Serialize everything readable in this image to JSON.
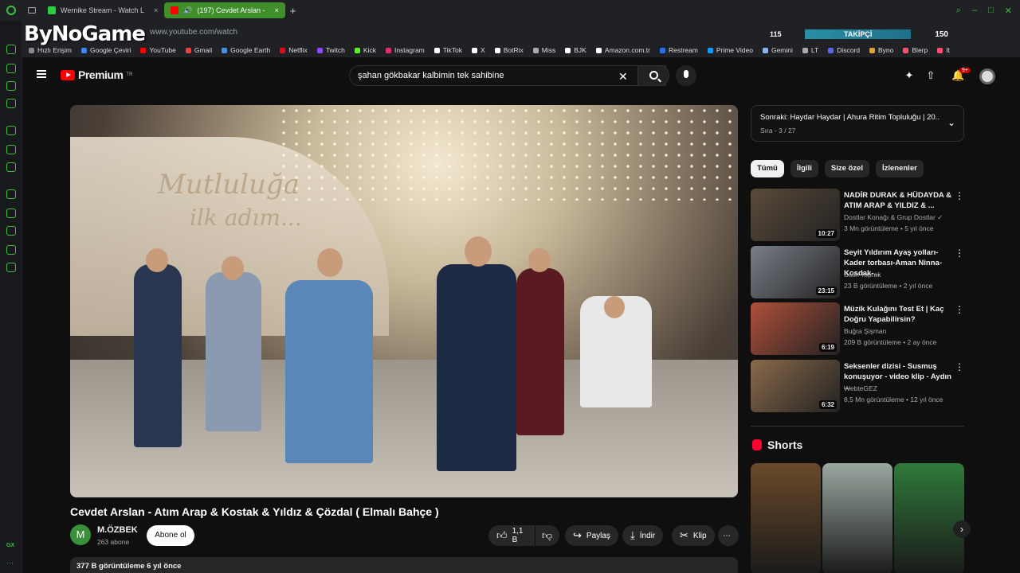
{
  "browser": {
    "tabs": [
      {
        "label": "Wernike Stream - Watch L",
        "color": "#2ecc40"
      },
      {
        "label": "(197) Cevdet Arslan -",
        "color": "#ff0000"
      }
    ],
    "new_tab": "+",
    "url": "www.youtube.com/watch",
    "bookmarks": [
      {
        "label": "Hızlı Erişim",
        "color": "#888"
      },
      {
        "label": "Google Çeviri",
        "color": "#4285f4"
      },
      {
        "label": "YouTube",
        "color": "#ff0000"
      },
      {
        "label": "Gmail",
        "color": "#ea4335"
      },
      {
        "label": "Google Earth",
        "color": "#4a90d9"
      },
      {
        "label": "Netflix",
        "color": "#e50914"
      },
      {
        "label": "Twitch",
        "color": "#9146ff"
      },
      {
        "label": "Kick",
        "color": "#53fc18"
      },
      {
        "label": "Instagram",
        "color": "#e1306c"
      },
      {
        "label": "TikTok",
        "color": "#fff"
      },
      {
        "label": "X",
        "color": "#fff"
      },
      {
        "label": "BotRix",
        "color": "#fff"
      },
      {
        "label": "Miss",
        "color": "#aaa"
      },
      {
        "label": "BJK",
        "color": "#fff"
      },
      {
        "label": "Amazon.com.tr",
        "color": "#fff"
      },
      {
        "label": "Restream",
        "color": "#2f6fed"
      },
      {
        "label": "Prime Video",
        "color": "#1a98ff"
      },
      {
        "label": "Gemini",
        "color": "#8ab4f8"
      },
      {
        "label": "LT",
        "color": "#aaa"
      },
      {
        "label": "Discord",
        "color": "#5865f2"
      },
      {
        "label": "Byno",
        "color": "#e0a030"
      },
      {
        "label": "Blerp",
        "color": "#ff4d6d"
      },
      {
        "label": "It",
        "color": "#ff4d6d"
      }
    ]
  },
  "overlay": {
    "logo": "ByNoGame",
    "follower_count": "115",
    "follower_label": "TAKİPÇİ",
    "viewer_count": "150"
  },
  "youtube": {
    "logo_text": "Premium",
    "logo_sup": "TR",
    "search_query": "şahan gökbakar kalbimin tek sahibine",
    "notif_badge": "9+"
  },
  "video": {
    "wall_text_1": "Mutluluğa",
    "wall_text_2": "ilk adım...",
    "title": "Cevdet Arslan - Atım Arap & Kostak & Yıldız & Çözdal ( Elmalı Bahçe )",
    "channel_initial": "M",
    "channel_name": "M.ÖZBEK",
    "subscribers": "263 abone",
    "subscribe_label": "Abone ol",
    "likes": "1,1 B",
    "share": "Paylaş",
    "download": "İndir",
    "clip": "Klip",
    "more": "⋯",
    "views_line": "377 B görüntüleme  6 yıl önce"
  },
  "playlist": {
    "next_title": "Sonraki: Haydar Haydar | Ahura Ritim Topluluğu | 20...",
    "position": "Sıra - 3 / 27"
  },
  "chips": [
    "Tümü",
    "İlgili",
    "Size özel",
    "İzlenenler"
  ],
  "recommendations": [
    {
      "title": "NADİR DURAK & HÜDAYDA & ATIM ARAP & YILDIZ & ...",
      "channel": "Dostlar Konağı & Grup Dostlar ✓",
      "meta": "3 Mn görüntüleme • 5 yıl önce",
      "duration": "10:27",
      "color": "#5a4a3a"
    },
    {
      "title": "Seyit Yıldırım Ayaş yolları-Kader torbası-Aman Ninna-Kosdak-...",
      "channel": "Salih Toprak",
      "meta": "23 B görüntüleme • 2 yıl önce",
      "duration": "23:15",
      "color": "#7a7f88"
    },
    {
      "title": "Müzik Kulağını Test Et | Kaç Doğru Yapabilirsin?",
      "channel": "Buğra Şişman",
      "meta": "209 B görüntüleme • 2 ay önce",
      "duration": "6:19",
      "color": "#b0503a"
    },
    {
      "title": "Seksenler dizisi - Susmuş konuşuyor - video klip - Aydın ...",
      "channel": "WebteGEZ",
      "meta": "8,5 Mn görüntüleme • 12 yıl önce",
      "duration": "6:32",
      "color": "#8a6a4a"
    }
  ],
  "shorts": {
    "title": "Shorts",
    "items": [
      {
        "color": "#6a4a2a"
      },
      {
        "color": "#9aa8a0"
      },
      {
        "color": "#2f7a3a"
      }
    ],
    "next": "›"
  }
}
